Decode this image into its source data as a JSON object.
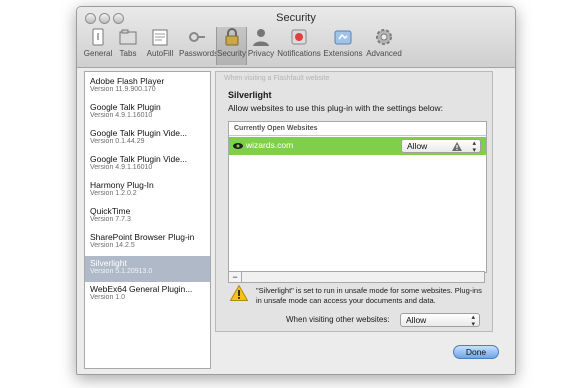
{
  "window": {
    "title": "Security"
  },
  "toolbar": [
    {
      "label": "General",
      "icon": "general-icon"
    },
    {
      "label": "Tabs",
      "icon": "tabs-icon"
    },
    {
      "label": "AutoFill",
      "icon": "autofill-icon"
    },
    {
      "label": "Passwords",
      "icon": "passwords-icon"
    },
    {
      "label": "Security",
      "icon": "security-lock-icon",
      "active": true
    },
    {
      "label": "Privacy",
      "icon": "privacy-icon"
    },
    {
      "label": "Notifications",
      "icon": "notifications-icon"
    },
    {
      "label": "Extensions",
      "icon": "extensions-icon"
    },
    {
      "label": "Advanced",
      "icon": "advanced-gear-icon"
    }
  ],
  "sidebar": {
    "plugins": [
      {
        "name": "Adobe Flash Player",
        "version": "Version 11.9.900.170"
      },
      {
        "name": "Google Talk Plugin",
        "version": "Version 4.9.1.16010"
      },
      {
        "name": "Google Talk Plugin Vide...",
        "version": "Version 0.1.44.29"
      },
      {
        "name": "Google Talk Plugin Vide...",
        "version": "Version 4.9.1.16010"
      },
      {
        "name": "Harmony Plug-In",
        "version": "Version 1.2.0.2"
      },
      {
        "name": "QuickTime",
        "version": "Version 7.7.3"
      },
      {
        "name": "SharePoint Browser Plug-in",
        "version": "Version 14.2.5"
      },
      {
        "name": "Silverlight",
        "version": "Version 5.1.20913.0",
        "selected": true
      },
      {
        "name": "WebEx64 General Plugin...",
        "version": "Version 1.0"
      }
    ]
  },
  "panel": {
    "ghost_text": "When visiting a Flashfault website",
    "title": "Silverlight",
    "description": "Allow websites to use this plug-in with the settings below:",
    "table_header": "Currently Open Websites",
    "rows": [
      {
        "site": "wizards.com",
        "setting": "Allow"
      }
    ],
    "warning": "\"Silverlight\" is set to run in unsafe mode for some websites. Plug-ins in unsafe mode can access your documents and data.",
    "other_label": "When visiting other websites:",
    "other_value": "Allow",
    "remove_label": "−"
  },
  "footer": {
    "done_label": "Done"
  },
  "colors": {
    "accent_green": "#7fcf4c",
    "selection": "#b0b9c8",
    "done_button": "#6ea6ea"
  }
}
